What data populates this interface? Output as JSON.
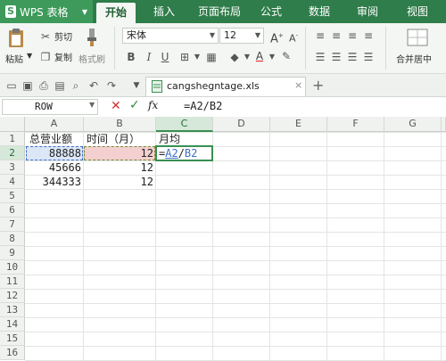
{
  "app": {
    "logo_letter": "S",
    "title": "WPS 表格"
  },
  "menu": {
    "tabs": [
      {
        "label": "开始"
      },
      {
        "label": "插入"
      },
      {
        "label": "页面布局"
      },
      {
        "label": "公式"
      },
      {
        "label": "数据"
      },
      {
        "label": "审阅"
      },
      {
        "label": "视图"
      }
    ]
  },
  "ribbon": {
    "cut_label": "剪切",
    "paste_label": "粘贴",
    "copy_label": "复制",
    "format_painter_label": "格式刷",
    "font_name": "宋体",
    "font_size": "12",
    "merge_label": "合并居中"
  },
  "file_tab": {
    "name": "cangshegntage.xls"
  },
  "formula_bar": {
    "name_box": "ROW",
    "fx_label": "fx",
    "formula": "=A2/B2"
  },
  "columns": [
    "A",
    "B",
    "C",
    "D",
    "E",
    "F",
    "G"
  ],
  "rows": [
    "1",
    "2",
    "3",
    "4",
    "5",
    "6",
    "7",
    "8",
    "9",
    "10",
    "11",
    "12",
    "13",
    "14",
    "15",
    "16"
  ],
  "cells": {
    "A1": "总营业额",
    "B1": "时间（月）",
    "C1": "月均",
    "A2": "88888",
    "B2": "12",
    "C2_eq": "=",
    "C2_a": "A2",
    "C2_op": "/",
    "C2_b": "B2",
    "A3": "45666",
    "B3": "12",
    "A4": "344333",
    "B4": "12"
  },
  "colors": {
    "menubar": "#2f7d4a",
    "accent": "#3a8f52",
    "ref_a": "#3b6fc9",
    "ref_b": "#d9534f"
  }
}
